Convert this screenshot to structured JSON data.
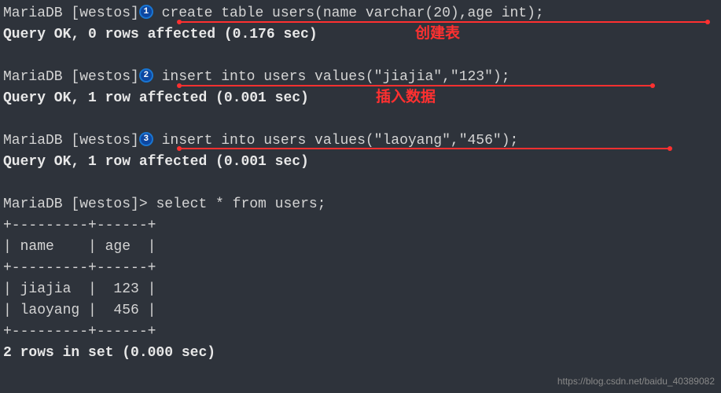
{
  "lines": {
    "l1_prompt": "MariaDB [westos]",
    "l1_cmd": " create table users(name varchar(20),age int);",
    "l2": "Query OK, 0 rows affected (0.176 sec)",
    "l3_prompt": "MariaDB [westos]",
    "l3_cmd": " insert into users values(\"jiajia\",\"123\");",
    "l4": "Query OK, 1 row affected (0.001 sec)",
    "l5_prompt": "MariaDB [westos]",
    "l5_cmd": " insert into users values(\"laoyang\",\"456\");",
    "l6": "Query OK, 1 row affected (0.001 sec)",
    "l7_prompt": "MariaDB [westos]> ",
    "l7_cmd": "select * from users;",
    "t_border": "+---------+------+",
    "t_header": "| name    | age  |",
    "t_row1": "| jiajia  |  123 |",
    "t_row2": "| laoyang |  456 |",
    "t_footer": "2 rows in set (0.000 sec)"
  },
  "markers": {
    "m1": "1",
    "m2": "2",
    "m3": "3"
  },
  "annotations": {
    "a1": "创建表",
    "a2": "插入数据"
  },
  "chart_data": {
    "type": "table",
    "columns": [
      "name",
      "age"
    ],
    "rows": [
      {
        "name": "jiajia",
        "age": 123
      },
      {
        "name": "laoyang",
        "age": 456
      }
    ]
  },
  "watermark": "https://blog.csdn.net/baidu_40389082"
}
